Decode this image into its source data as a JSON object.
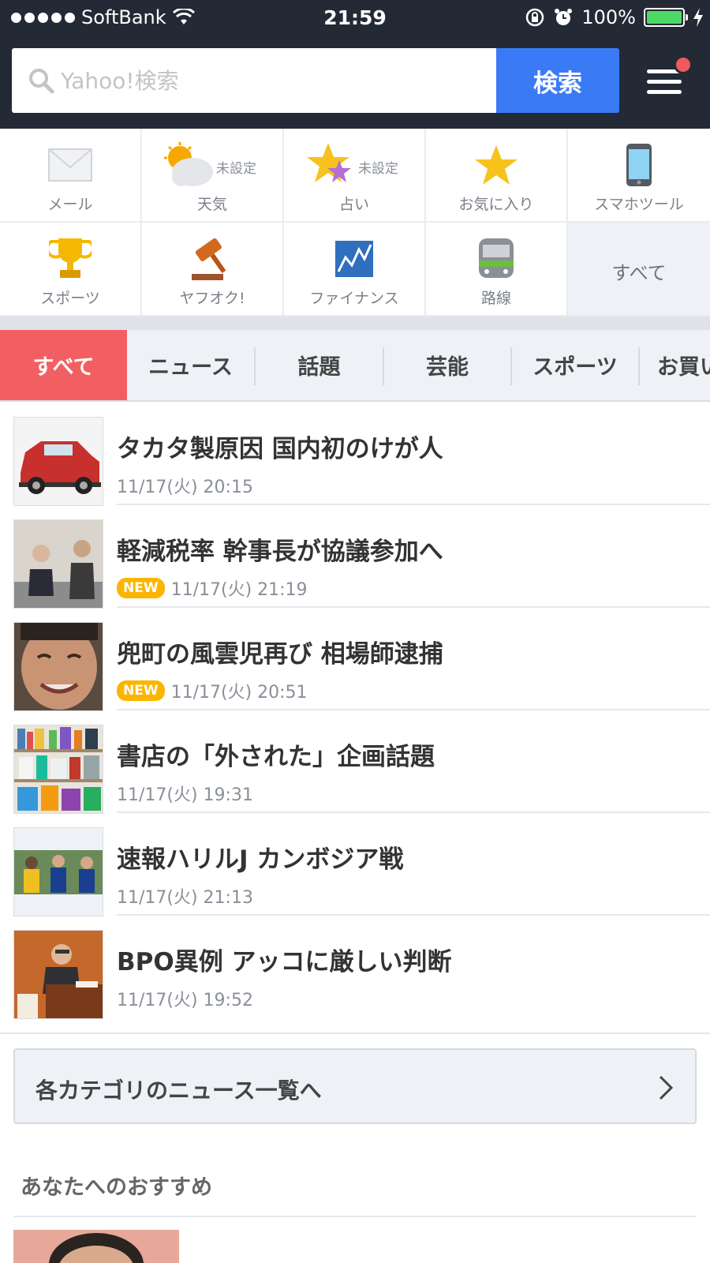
{
  "status_bar": {
    "carrier": "SoftBank",
    "time": "21:59",
    "battery": "100%"
  },
  "search": {
    "placeholder": "Yahoo!検索",
    "button_label": "検索"
  },
  "services": [
    {
      "label": "メール",
      "icon": "mail-icon",
      "note": ""
    },
    {
      "label": "天気",
      "icon": "weather-icon",
      "note": "未設定"
    },
    {
      "label": "占い",
      "icon": "fortune-star-icon",
      "note": "未設定"
    },
    {
      "label": "お気に入り",
      "icon": "star-icon",
      "note": ""
    },
    {
      "label": "スマホツール",
      "icon": "smartphone-icon",
      "note": ""
    },
    {
      "label": "スポーツ",
      "icon": "trophy-icon",
      "note": ""
    },
    {
      "label": "ヤフオク!",
      "icon": "auction-gavel-icon",
      "note": ""
    },
    {
      "label": "ファイナンス",
      "icon": "finance-chart-icon",
      "note": ""
    },
    {
      "label": "路線",
      "icon": "train-icon",
      "note": ""
    },
    {
      "label": "すべて",
      "icon": "",
      "note": ""
    }
  ],
  "tabs": [
    "すべて",
    "ニュース",
    "話題",
    "芸能",
    "スポーツ",
    "お買い"
  ],
  "news": [
    {
      "title": "タカタ製原因 国内初のけが人",
      "date": "11/17(火) 20:15",
      "new": false
    },
    {
      "title": "軽減税率 幹事長が協議参加へ",
      "date": "11/17(火) 21:19",
      "new": true
    },
    {
      "title": "兜町の風雲児再び 相場師逮捕",
      "date": "11/17(火) 20:51",
      "new": true
    },
    {
      "title": "書店の「外された」企画話題",
      "date": "11/17(火) 19:31",
      "new": false
    },
    {
      "title": "速報ハリルJ カンボジア戦",
      "date": "11/17(火) 21:13",
      "new": false
    },
    {
      "title": "BPO異例 アッコに厳しい判断",
      "date": "11/17(火) 19:52",
      "new": false
    }
  ],
  "new_badge": "NEW",
  "category_link": "各カテゴリのニュース一覧へ",
  "recommend_title": "あなたへのおすすめ",
  "colors": {
    "header_bg": "#232a36",
    "search_button": "#3a7bf5",
    "active_tab": "#f25f63",
    "new_badge": "#fbb500",
    "menu_notification": "#f05a5a"
  }
}
